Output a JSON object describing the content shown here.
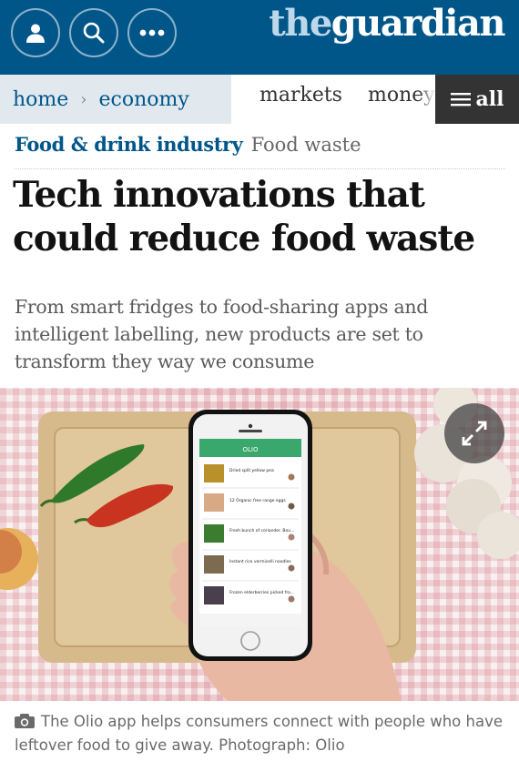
{
  "header": {
    "logo_the": "the",
    "logo_guardian": "guardian",
    "buttons": [
      {
        "icon": "profile-icon"
      },
      {
        "icon": "search-icon"
      },
      {
        "icon": "more-icon"
      }
    ],
    "brand_color": "#005689"
  },
  "nav": {
    "home": "home",
    "separator": "›",
    "section": "economy",
    "items": [
      "markets",
      "money"
    ],
    "all_label": "all",
    "all_icon": "menu-icon"
  },
  "article": {
    "tag_main": "Food & drink industry",
    "tag_sub": "Food waste",
    "headline": "Tech innovations that could reduce food waste",
    "standfirst": "From smart fridges to food-sharing apps and intelligent labelling, new products are set to transform they way we consume"
  },
  "image": {
    "expand_icon": "expand-icon",
    "app_name": "OLIO",
    "app_items": [
      "Dried split yellow pea",
      "12 Organic free range eggs",
      "Fresh bunch of coriander. Bou...",
      "Instant rice vermicelli noodles",
      "Frozen elderberries picked fro..."
    ]
  },
  "caption": {
    "icon": "camera-icon",
    "text": "The Olio app helps consumers connect with people who have leftover food to give away. Photograph: Olio"
  }
}
